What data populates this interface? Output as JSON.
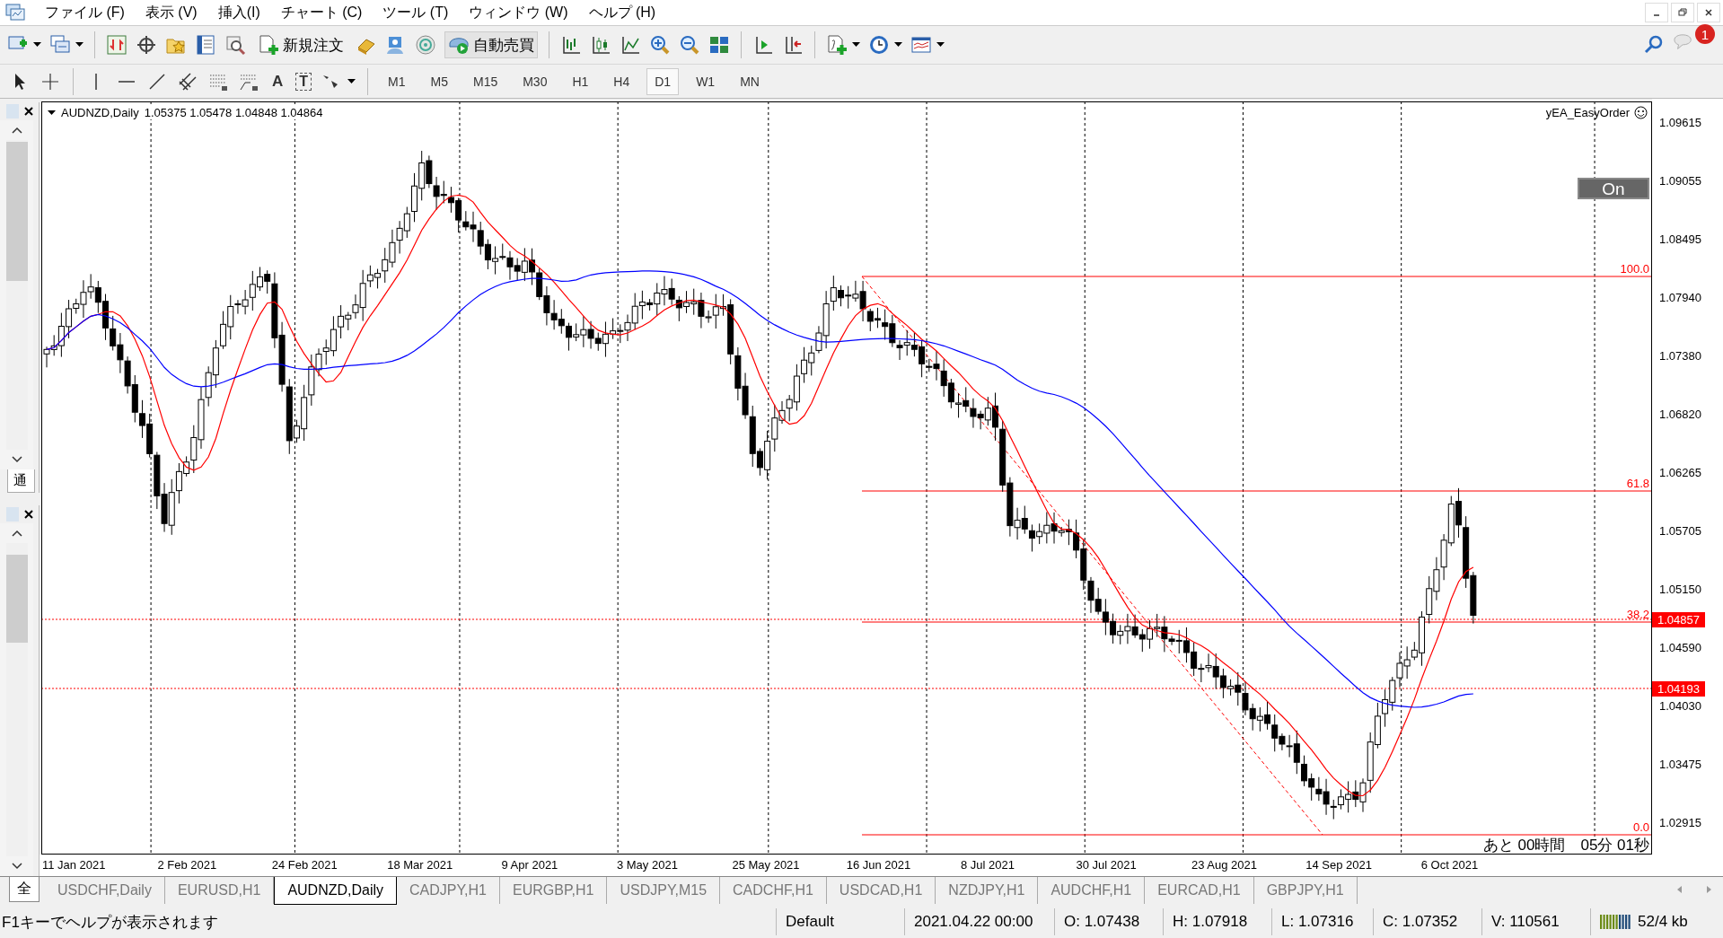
{
  "menu": [
    "ファイル (F)",
    "表示 (V)",
    "挿入(I)",
    "チャート (C)",
    "ツール (T)",
    "ウィンドウ (W)",
    "ヘルプ (H)"
  ],
  "toolbar": {
    "buttons": [
      "新規注文",
      "自動売買"
    ],
    "notification_count": "1"
  },
  "drawing_toolbar": {
    "text_tools": [
      "A",
      "T"
    ],
    "timeframes": [
      {
        "label": "M1",
        "selected": false
      },
      {
        "label": "M5",
        "selected": false
      },
      {
        "label": "M15",
        "selected": false
      },
      {
        "label": "M30",
        "selected": false
      },
      {
        "label": "H1",
        "selected": false
      },
      {
        "label": "H4",
        "selected": false
      },
      {
        "label": "D1",
        "selected": true
      },
      {
        "label": "W1",
        "selected": false
      },
      {
        "label": "MN",
        "selected": false
      }
    ]
  },
  "side_panels": [
    {
      "tab": "通"
    },
    {
      "tab": "全"
    }
  ],
  "chart": {
    "symbol": "AUDNZD,Daily",
    "ohlc": "1.05375 1.05478 1.04848 1.04864",
    "expert": "yEA_EasyOrder",
    "toggle_button": "On",
    "price_ticks": [
      "1.09615",
      "1.09055",
      "1.08495",
      "1.07940",
      "1.07380",
      "1.06820",
      "1.06265",
      "1.05705",
      "1.05150",
      "1.04590",
      "1.04030",
      "1.03475",
      "1.02915"
    ],
    "date_ticks": [
      "11 Jan 2021",
      "2 Feb 2021",
      "24 Feb 2021",
      "18 Mar 2021",
      "9 Apr 2021",
      "3 May 2021",
      "25 May 2021",
      "16 Jun 2021",
      "8 Jul 2021",
      "30 Jul 2021",
      "23 Aug 2021",
      "14 Sep 2021",
      "6 Oct 2021"
    ],
    "fibonacci_levels": [
      "100.0",
      "61.8",
      "38.2",
      "0.0"
    ],
    "price_tags": [
      "1.04857",
      "1.04193"
    ],
    "countdown": "あと 00時間　05分 01秒"
  },
  "tabs": [
    {
      "label": "USDCHF,Daily",
      "selected": false
    },
    {
      "label": "EURUSD,H1",
      "selected": false
    },
    {
      "label": "AUDNZD,Daily",
      "selected": true
    },
    {
      "label": "CADJPY,H1",
      "selected": false
    },
    {
      "label": "EURGBP,H1",
      "selected": false
    },
    {
      "label": "USDJPY,M15",
      "selected": false
    },
    {
      "label": "CADCHF,H1",
      "selected": false
    },
    {
      "label": "USDCAD,H1",
      "selected": false
    },
    {
      "label": "NZDJPY,H1",
      "selected": false
    },
    {
      "label": "AUDCHF,H1",
      "selected": false
    },
    {
      "label": "EURCAD,H1",
      "selected": false
    },
    {
      "label": "GBPJPY,H1",
      "selected": false
    }
  ],
  "status_bar": {
    "help": "F1キーでヘルプが表示されます",
    "profile": "Default",
    "datetime": "2021.04.22 00:00",
    "open": "O: 1.07438",
    "high": "H: 1.07918",
    "low": "L: 1.07316",
    "close": "C: 1.07352",
    "volume": "V: 110561",
    "traffic": "52/4 kb"
  }
}
